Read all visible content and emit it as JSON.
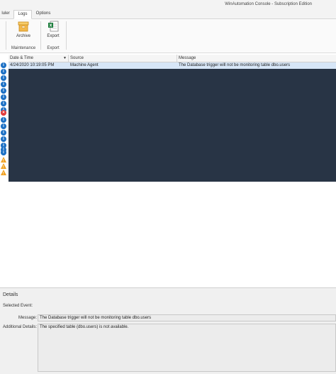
{
  "window": {
    "title": "WinAutomation Console - Subscription Edition"
  },
  "tabs": [
    {
      "label": "luler",
      "active": false
    },
    {
      "label": "Logs",
      "active": true
    },
    {
      "label": "Options",
      "active": false
    }
  ],
  "ribbon": {
    "groups": [
      {
        "label": "Maintenance",
        "buttons": [
          {
            "label": "Archive",
            "icon": "archive-icon"
          }
        ]
      },
      {
        "label": "Export",
        "buttons": [
          {
            "label": "Export",
            "icon": "export-excel-icon"
          }
        ]
      }
    ]
  },
  "grid": {
    "columns": [
      "Date & Time",
      "Source",
      "Message"
    ],
    "sort_column": "Date & Time",
    "selected_row": {
      "date_time": "4/24/2020 10:19:05 PM",
      "source": "Machine Agent",
      "message": "The Database trigger will not be monitoring table dbo.users"
    },
    "row_icons": [
      "info",
      "info",
      "info",
      "info",
      "info",
      "info",
      "info",
      "info",
      "error",
      "info",
      "info",
      "info",
      "info",
      "info",
      "info",
      "info",
      "warning",
      "warning",
      "warning"
    ]
  },
  "details": {
    "title": "Details",
    "selected_event_label": "Selected Event:",
    "message_label": "Message:",
    "message_value": "The Database trigger will not be monitoring table dbo.users",
    "additional_label": "Additional Details:",
    "additional_value": "The specified table (dbo.users) is not available."
  },
  "colors": {
    "info": "#1b6fc4",
    "error": "#e23a3a",
    "warning": "#f0a020",
    "selection": "#d7e6f7",
    "dark_area": "#283445"
  }
}
